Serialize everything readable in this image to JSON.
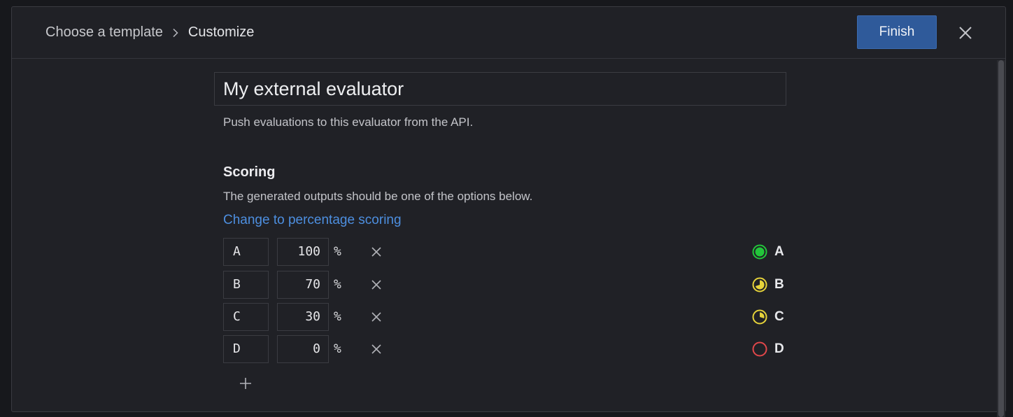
{
  "header": {
    "breadcrumb": [
      {
        "label": "Choose a template"
      },
      {
        "label": "Customize"
      }
    ],
    "finish_label": "Finish",
    "close_icon": "close-icon"
  },
  "evaluator": {
    "name_value": "My external evaluator",
    "description": "Push evaluations to this evaluator from the API."
  },
  "scoring": {
    "title": "Scoring",
    "description": "The generated outputs should be one of the options below.",
    "change_link": "Change to percentage scoring",
    "percent_symbol": "%",
    "rows": [
      {
        "grade": "A",
        "percent": "100",
        "preview_label": "A",
        "preview_icon": "full-circle-icon",
        "color": "#22c63a",
        "fraction": 1.0
      },
      {
        "grade": "B",
        "percent": "70",
        "preview_label": "B",
        "preview_icon": "three-quarter-circle-icon",
        "color": "#e6d33a",
        "fraction": 0.7
      },
      {
        "grade": "C",
        "percent": "30",
        "preview_label": "C",
        "preview_icon": "quarter-circle-icon",
        "color": "#e6d33a",
        "fraction": 0.3
      },
      {
        "grade": "D",
        "percent": "0",
        "preview_label": "D",
        "preview_icon": "empty-circle-icon",
        "color": "#e0474a",
        "fraction": 0.0
      }
    ],
    "add_icon": "plus-icon"
  },
  "colors": {
    "accent": "#2f5a9a",
    "link": "#4d8fe0",
    "background": "#202126"
  }
}
